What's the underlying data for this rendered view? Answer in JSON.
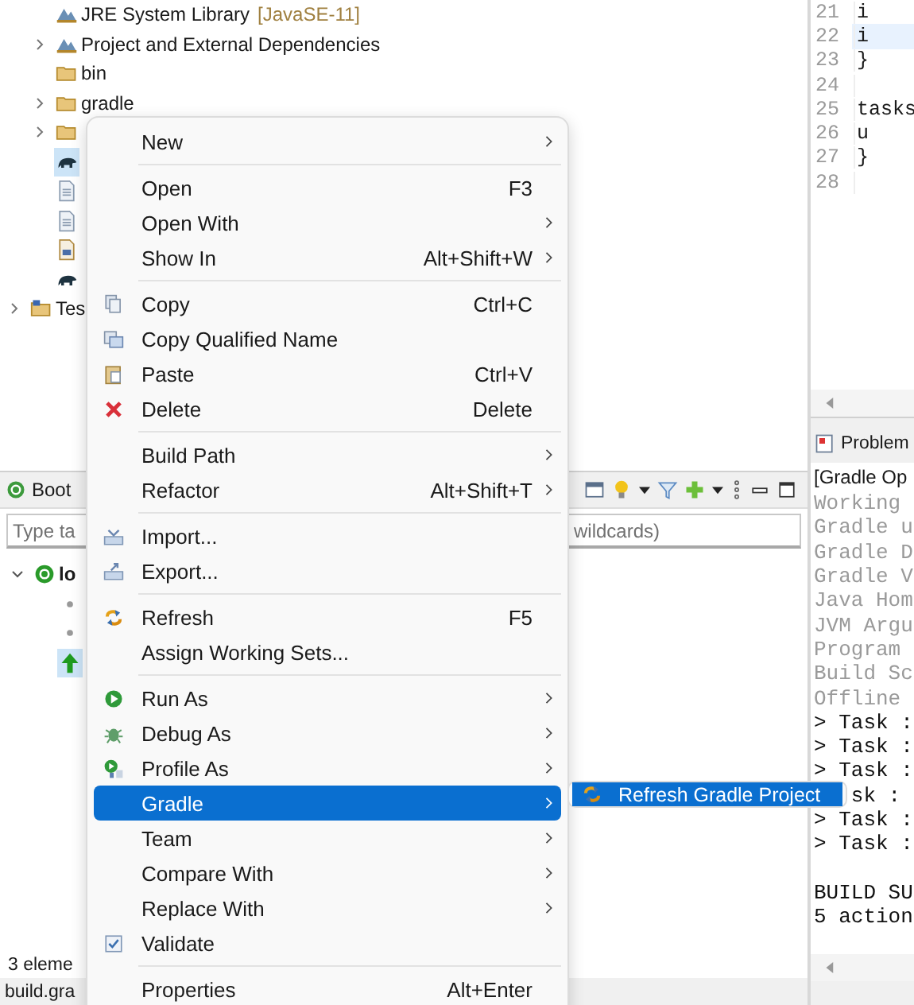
{
  "project_explorer": {
    "tree": [
      {
        "children": [
          {
            "label": "JRE System Library",
            "note": "[JavaSE-11]",
            "kind": "library",
            "selected": false
          },
          {
            "label": "Project and External Dependencies",
            "kind": "library",
            "expanded": false,
            "selected": false
          },
          {
            "label": "bin",
            "kind": "folder",
            "selected": false
          },
          {
            "label": "gradle",
            "kind": "folder",
            "expanded": false,
            "selected": false
          },
          {
            "kind": "folder",
            "expanded": false,
            "selected": false
          },
          {
            "kind": "gradle",
            "selected": true
          },
          {
            "kind": "text-file",
            "selected": false
          },
          {
            "kind": "text-file",
            "selected": false
          },
          {
            "kind": "doc-file",
            "selected": false
          },
          {
            "kind": "gradle",
            "selected": false
          }
        ]
      },
      {
        "label": "Tes",
        "kind": "project",
        "expanded": false,
        "selected": false
      }
    ]
  },
  "boot_dashboard": {
    "tab": "Boot",
    "filter": {
      "placeholder_start": "Type ta",
      "placeholder_end": "wildcards)"
    },
    "tree": [
      {
        "label": "lo",
        "expanded": true,
        "children": [
          {
            "kind": "bullet",
            "selected": false
          },
          {
            "kind": "bullet",
            "selected": false
          },
          {
            "kind": "arrow",
            "selected": true
          }
        ]
      }
    ],
    "status": "3 eleme"
  },
  "status_bar": "build.gra",
  "editor": {
    "lines": [
      {
        "number": "21",
        "code": "i",
        "current": false
      },
      {
        "number": "22",
        "code": "i",
        "current": true
      },
      {
        "number": "23",
        "code": "}",
        "current": false
      },
      {
        "number": "24",
        "current": false
      },
      {
        "number": "25",
        "code": "tasks",
        "current": false
      },
      {
        "number": "26",
        "code": "u",
        "current": false
      },
      {
        "number": "27",
        "code": "}",
        "current": false
      },
      {
        "number": "28",
        "current": false
      }
    ]
  },
  "console": {
    "tab": "Problem",
    "title": "[Gradle Op",
    "lines": [
      {
        "text": "Working",
        "kind": "info"
      },
      {
        "text": "Gradle u",
        "kind": "info"
      },
      {
        "text": "Gradle D",
        "kind": "info"
      },
      {
        "text": "Gradle V",
        "kind": "info"
      },
      {
        "text": "Java Hom",
        "kind": "info"
      },
      {
        "text": "JVM Argu",
        "kind": "info"
      },
      {
        "text": "Program",
        "kind": "info"
      },
      {
        "text": "Build Sc",
        "kind": "info"
      },
      {
        "text": "Offline",
        "kind": "info"
      },
      {
        "text": "> Task :",
        "kind": "output"
      },
      {
        "text": "> Task :",
        "kind": "output"
      },
      {
        "text": "> Task :",
        "kind": "output"
      },
      {
        "text": "sk :",
        "kind": "covered"
      },
      {
        "text": "> Task :",
        "kind": "output"
      },
      {
        "text": "> Task :",
        "kind": "output"
      },
      {
        "kind": "blank"
      },
      {
        "text": "BUILD SU",
        "kind": "output"
      },
      {
        "text": "5 action",
        "kind": "output"
      }
    ]
  },
  "context_menu": {
    "items": [
      {
        "kind": "plain",
        "label": "New",
        "submenu": true,
        "selected": false
      },
      {
        "kind": "separator"
      },
      {
        "kind": "plain",
        "label": "Open",
        "shortcut": "F3",
        "selected": false
      },
      {
        "kind": "plain",
        "label": "Open With",
        "submenu": true,
        "selected": false
      },
      {
        "kind": "plain",
        "label": "Show In",
        "shortcut": "Alt+Shift+W",
        "submenu": true,
        "selected": false
      },
      {
        "kind": "separator"
      },
      {
        "kind": "copy",
        "label": "Copy",
        "shortcut": "Ctrl+C",
        "selected": false
      },
      {
        "kind": "copy-qualified",
        "label": "Copy Qualified Name",
        "selected": false
      },
      {
        "kind": "paste",
        "label": "Paste",
        "shortcut": "Ctrl+V",
        "selected": false
      },
      {
        "kind": "delete",
        "label": "Delete",
        "shortcut": "Delete",
        "selected": false
      },
      {
        "kind": "separator"
      },
      {
        "kind": "plain",
        "label": "Build Path",
        "submenu": true,
        "selected": false
      },
      {
        "kind": "plain",
        "label": "Refactor",
        "shortcut": "Alt+Shift+T",
        "submenu": true,
        "selected": false
      },
      {
        "kind": "separator"
      },
      {
        "kind": "import",
        "label": "Import...",
        "selected": false
      },
      {
        "kind": "export",
        "label": "Export...",
        "selected": false
      },
      {
        "kind": "separator"
      },
      {
        "kind": "refresh",
        "label": "Refresh",
        "shortcut": "F5",
        "selected": false
      },
      {
        "kind": "plain",
        "label": "Assign Working Sets...",
        "selected": false
      },
      {
        "kind": "separator"
      },
      {
        "kind": "run",
        "label": "Run As",
        "submenu": true,
        "selected": false
      },
      {
        "kind": "debug",
        "label": "Debug As",
        "submenu": true,
        "selected": false
      },
      {
        "kind": "profile",
        "label": "Profile As",
        "submenu": true,
        "selected": false
      },
      {
        "kind": "plain",
        "label": "Gradle",
        "submenu": true,
        "selected": true
      },
      {
        "kind": "plain",
        "label": "Team",
        "submenu": true,
        "selected": false
      },
      {
        "kind": "plain",
        "label": "Compare With",
        "submenu": true,
        "selected": false
      },
      {
        "kind": "plain",
        "label": "Replace With",
        "submenu": true,
        "selected": false
      },
      {
        "kind": "validate",
        "label": "Validate",
        "selected": false
      },
      {
        "kind": "separator"
      },
      {
        "kind": "plain",
        "label": "Properties",
        "shortcut": "Alt+Enter",
        "selected": false
      }
    ]
  },
  "submenu": {
    "items": [
      {
        "kind": "refresh",
        "label": "Refresh Gradle Project",
        "selected": true
      }
    ]
  }
}
